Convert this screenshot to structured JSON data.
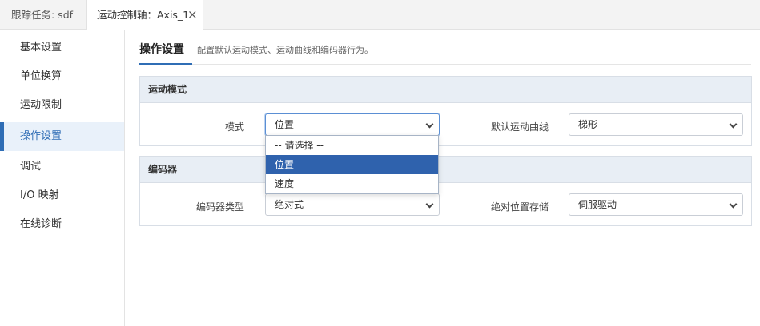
{
  "tabs": [
    {
      "label": "跟踪任务: sdf"
    },
    {
      "label": "运动控制轴：Axis_1"
    }
  ],
  "sidebar": {
    "items": [
      {
        "label": "基本设置"
      },
      {
        "label": "单位换算"
      },
      {
        "label": "运动限制"
      },
      {
        "label": "操作设置"
      },
      {
        "label": "调试"
      },
      {
        "label": "I/O 映射"
      },
      {
        "label": "在线诊断"
      }
    ],
    "active_index": 3
  },
  "header": {
    "title": "操作设置",
    "description": "配置默认运动模式、运动曲线和编码器行为。"
  },
  "motion_panel": {
    "title": "运动模式",
    "mode_label": "模式",
    "mode_value": "位置",
    "curve_label": "默认运动曲线",
    "curve_value": "梯形"
  },
  "encoder_panel": {
    "title": "编码器",
    "type_label": "编码器类型",
    "type_value": "绝对式",
    "storage_label": "绝对位置存储",
    "storage_value": "伺服驱动"
  },
  "mode_dropdown": {
    "options": [
      "-- 请选择 --",
      "位置",
      "速度"
    ],
    "selected_index": 1
  },
  "colors": {
    "accent": "#2f6db5",
    "panel_header": "#e8eef5",
    "selected_option": "#2f62ad"
  }
}
